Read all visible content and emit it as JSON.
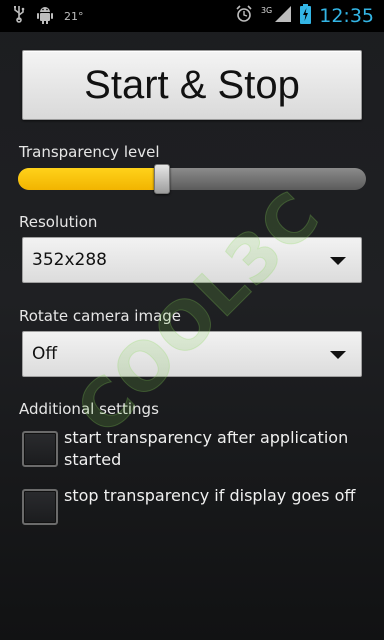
{
  "status_bar": {
    "left_icons": [
      "usb-icon",
      "android-debug-icon"
    ],
    "temperature": "21°",
    "network": "3G",
    "time": "12:35",
    "right_icons": [
      "alarm-icon",
      "signal-icon",
      "battery-charging-icon"
    ]
  },
  "main": {
    "start_stop_label": "Start & Stop",
    "transparency_label": "Transparency level",
    "transparency_level_fraction": 0.41,
    "resolution_label": "Resolution",
    "resolution_value": "352x288",
    "rotate_label": "Rotate camera image",
    "rotate_value": "Off",
    "additional_label": "Additional settings",
    "checkboxes": [
      {
        "label": "start transparency after application started",
        "checked": false
      },
      {
        "label": "stop transparency if display goes off",
        "checked": false
      }
    ]
  },
  "watermark": {
    "text": "COOL3C"
  },
  "colors": {
    "slider_fill": "#f5c000",
    "clock": "#33b5e5",
    "background": "#1e1f22"
  }
}
